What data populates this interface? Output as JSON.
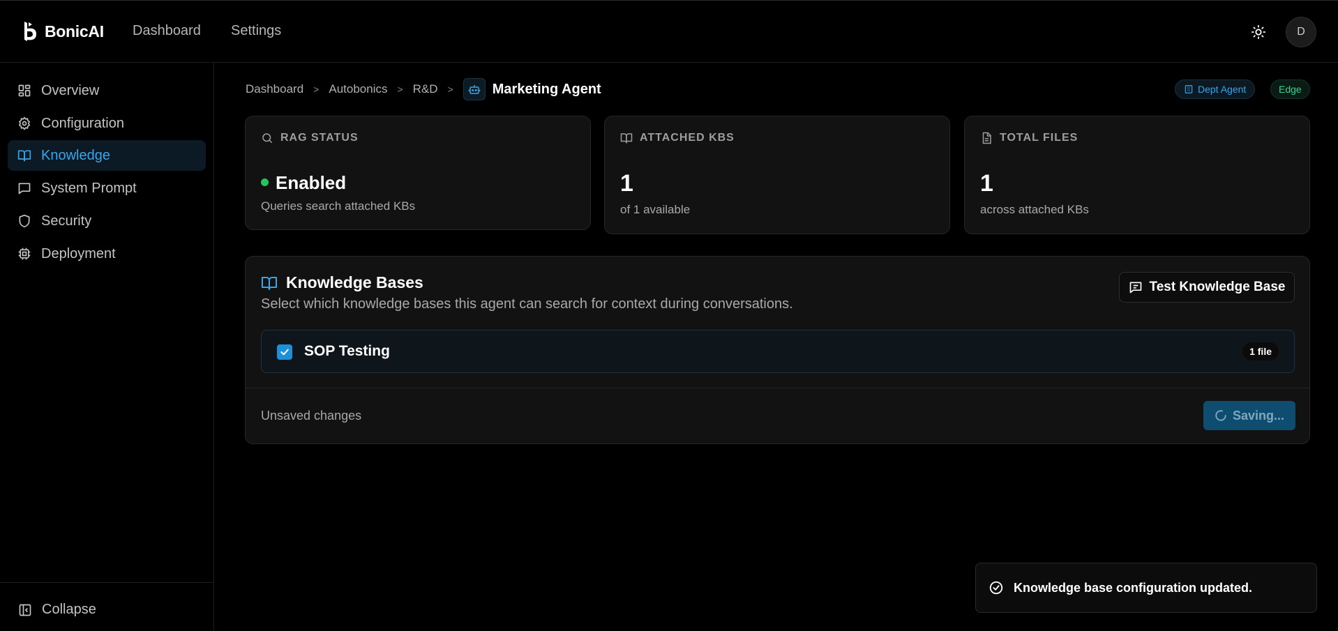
{
  "app": {
    "name": "BonicAI",
    "user_initial": "D"
  },
  "topnav": {
    "dashboard": "Dashboard",
    "settings": "Settings"
  },
  "sidebar": {
    "items": [
      {
        "label": "Overview",
        "icon": "grid-icon"
      },
      {
        "label": "Configuration",
        "icon": "gear-icon"
      },
      {
        "label": "Knowledge",
        "icon": "book-icon",
        "active": true
      },
      {
        "label": "System Prompt",
        "icon": "message-square-icon"
      },
      {
        "label": "Security",
        "icon": "shield-icon"
      },
      {
        "label": "Deployment",
        "icon": "chip-icon"
      }
    ],
    "collapse_label": "Collapse"
  },
  "breadcrumb": {
    "items": [
      "Dashboard",
      "Autobonics",
      "R&D"
    ],
    "separator": ">",
    "current": "Marketing Agent"
  },
  "badges": {
    "dept": "Dept Agent",
    "edge": "Edge"
  },
  "stats": {
    "rag": {
      "title": "RAG STATUS",
      "value": "Enabled",
      "sub": "Queries search attached KBs"
    },
    "kbs": {
      "title": "ATTACHED KBS",
      "value": "1",
      "sub": "of 1 available"
    },
    "files": {
      "title": "TOTAL FILES",
      "value": "1",
      "sub": "across attached KBs"
    }
  },
  "knowledge_bases": {
    "title": "Knowledge Bases",
    "description": "Select which knowledge bases this agent can search for context during conversations.",
    "test_button": "Test Knowledge Base",
    "items": [
      {
        "name": "SOP Testing",
        "files": "1 file",
        "checked": true
      }
    ],
    "unsaved": "Unsaved changes",
    "save_button": "Saving..."
  },
  "toast": {
    "message": "Knowledge base configuration updated."
  },
  "colors": {
    "accent": "#3aa6ea",
    "success": "#22c55e",
    "edge": "#3ad28f",
    "primary_button": "#0e4d70"
  }
}
